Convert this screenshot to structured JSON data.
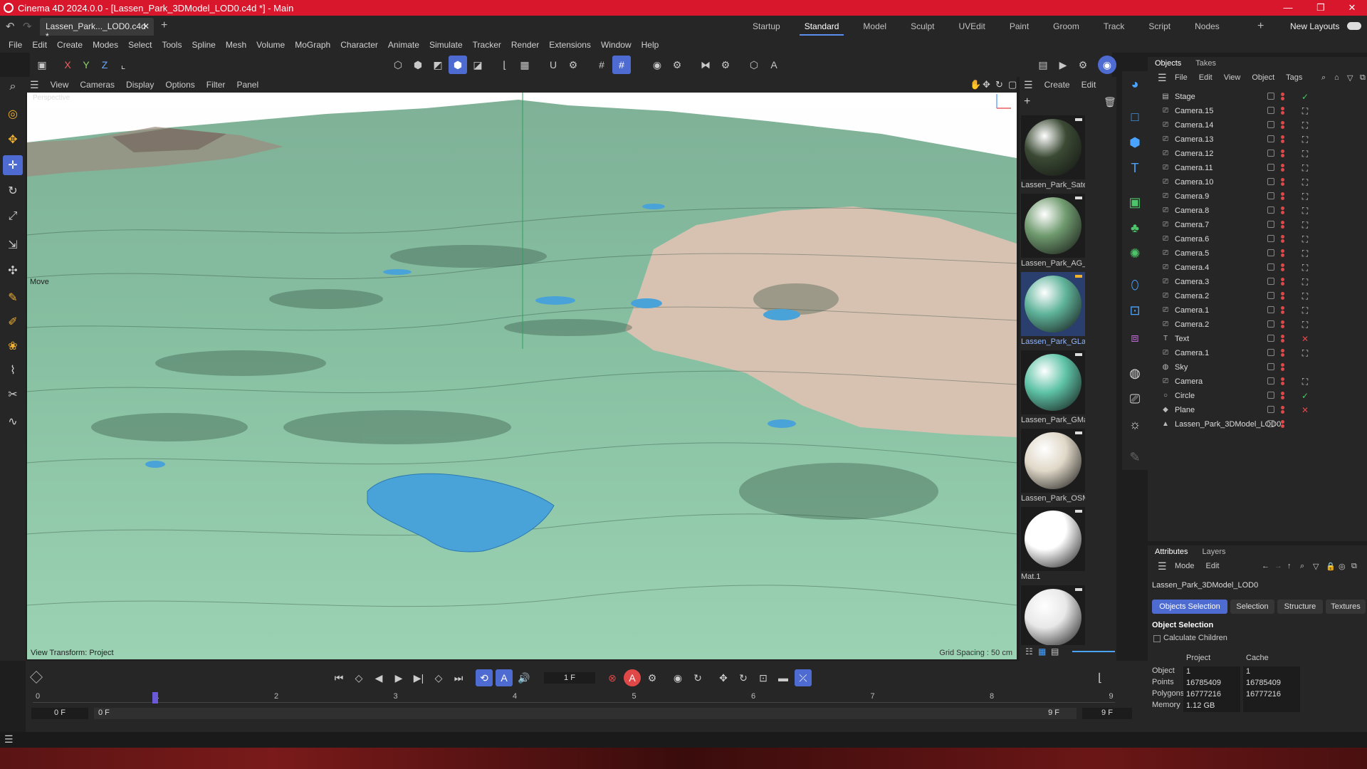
{
  "window": {
    "title": "Cinema 4D 2024.0.0 - [Lassen_Park_3DModel_LOD0.c4d *] - Main"
  },
  "tabs": {
    "file_tab": "Lassen_Park..._LOD0.c4d *",
    "new_layouts": "New Layouts"
  },
  "layouts": [
    "Startup",
    "Standard",
    "Model",
    "Sculpt",
    "UVEdit",
    "Paint",
    "Groom",
    "Track",
    "Script",
    "Nodes"
  ],
  "active_layout": "Standard",
  "menu": [
    "File",
    "Edit",
    "Create",
    "Modes",
    "Select",
    "Tools",
    "Spline",
    "Mesh",
    "Volume",
    "MoGraph",
    "Character",
    "Animate",
    "Simulate",
    "Tracker",
    "Render",
    "Extensions",
    "Window",
    "Help"
  ],
  "toolbar": {
    "x_axis": "X",
    "y_axis": "Y",
    "z_axis": "Z"
  },
  "viewport": {
    "menu": [
      "View",
      "Cameras",
      "Display",
      "Options",
      "Filter",
      "Panel"
    ],
    "camera_label": "Perspective",
    "tool_label": "Move",
    "view_transform": "View Transform: Project",
    "grid_spacing": "Grid Spacing : 50 cm"
  },
  "materials": {
    "menu": [
      "Create",
      "Edit"
    ],
    "items": [
      {
        "name": "Lassen_Park_Satel",
        "color": "#3b4a34"
      },
      {
        "name": "Lassen_Park_AG_L",
        "color": "#6f9a6e"
      },
      {
        "name": "Lassen_Park_GLan",
        "color": "#5fb39a"
      },
      {
        "name": "Lassen_Park_GMa",
        "color": "#5ec3a6"
      },
      {
        "name": "Lassen_Park_OSM",
        "color": "#e0d8c8"
      },
      {
        "name": "Mat.1",
        "color": "#ffffff"
      },
      {
        "name": "",
        "color": "#e8e8e8"
      }
    ]
  },
  "objects": {
    "tabs": [
      "Objects",
      "Takes"
    ],
    "menu": [
      "File",
      "Edit",
      "View",
      "Object",
      "Tags"
    ],
    "items": [
      {
        "name": "Stage",
        "icon": "stage-icon",
        "state": "check"
      },
      {
        "name": "Camera.15",
        "icon": "camera-icon",
        "state": "target"
      },
      {
        "name": "Camera.14",
        "icon": "camera-icon",
        "state": "target"
      },
      {
        "name": "Camera.13",
        "icon": "camera-icon",
        "state": "target"
      },
      {
        "name": "Camera.12",
        "icon": "camera-icon",
        "state": "target"
      },
      {
        "name": "Camera.11",
        "icon": "camera-icon",
        "state": "target"
      },
      {
        "name": "Camera.10",
        "icon": "camera-icon",
        "state": "target"
      },
      {
        "name": "Camera.9",
        "icon": "camera-icon",
        "state": "target"
      },
      {
        "name": "Camera.8",
        "icon": "camera-icon",
        "state": "target"
      },
      {
        "name": "Camera.7",
        "icon": "camera-icon",
        "state": "target"
      },
      {
        "name": "Camera.6",
        "icon": "camera-icon",
        "state": "target"
      },
      {
        "name": "Camera.5",
        "icon": "camera-icon",
        "state": "target"
      },
      {
        "name": "Camera.4",
        "icon": "camera-icon",
        "state": "target"
      },
      {
        "name": "Camera.3",
        "icon": "camera-icon",
        "state": "target"
      },
      {
        "name": "Camera.2",
        "icon": "camera-icon",
        "state": "target"
      },
      {
        "name": "Camera.1",
        "icon": "camera-icon",
        "state": "target"
      },
      {
        "name": "Camera.2",
        "icon": "camera-icon",
        "state": "target"
      },
      {
        "name": "Text",
        "icon": "text-icon",
        "state": "cross"
      },
      {
        "name": "Camera.1",
        "icon": "camera-icon",
        "state": "target"
      },
      {
        "name": "Sky",
        "icon": "sky-icon",
        "state": ""
      },
      {
        "name": "Camera",
        "icon": "camera-icon",
        "state": "target"
      },
      {
        "name": "Circle",
        "icon": "circle-icon",
        "state": "check"
      },
      {
        "name": "Plane",
        "icon": "plane-icon",
        "state": "cross"
      },
      {
        "name": "Lassen_Park_3DModel_LOD0",
        "icon": "model-icon",
        "state": ""
      }
    ]
  },
  "attributes": {
    "tabs": [
      "Attributes",
      "Layers"
    ],
    "menu": [
      "Mode",
      "Edit"
    ],
    "object_name": "Lassen_Park_3DModel_LOD0",
    "buttons": [
      "Objects Selection",
      "Selection",
      "Structure",
      "Textures"
    ],
    "section": "Object Selection",
    "calc_children": "Calculate Children",
    "col_project": "Project",
    "col_cache": "Cache",
    "rows": [
      {
        "label": "Object",
        "project": "1",
        "cache": "1"
      },
      {
        "label": "Points",
        "project": "16785409",
        "cache": "16785409"
      },
      {
        "label": "Polygons",
        "project": "16777216",
        "cache": "16777216"
      },
      {
        "label": "Memory",
        "project": "1.12 GB",
        "cache": ""
      }
    ]
  },
  "timeline": {
    "frame": "1 F",
    "ticks": [
      "0",
      "1",
      "2",
      "3",
      "4",
      "5",
      "6",
      "7",
      "8",
      "9"
    ],
    "start": "0 F",
    "start2": "0 F",
    "end": "9 F",
    "end2": "9 F",
    "current_frame": 1
  },
  "colors": {
    "title_bar": "#d8162c",
    "accent": "#4e6bd1",
    "panel": "#262626",
    "terrain": "#8ac3a4",
    "land": "#d7c2b2",
    "water": "#4aa3d8"
  }
}
